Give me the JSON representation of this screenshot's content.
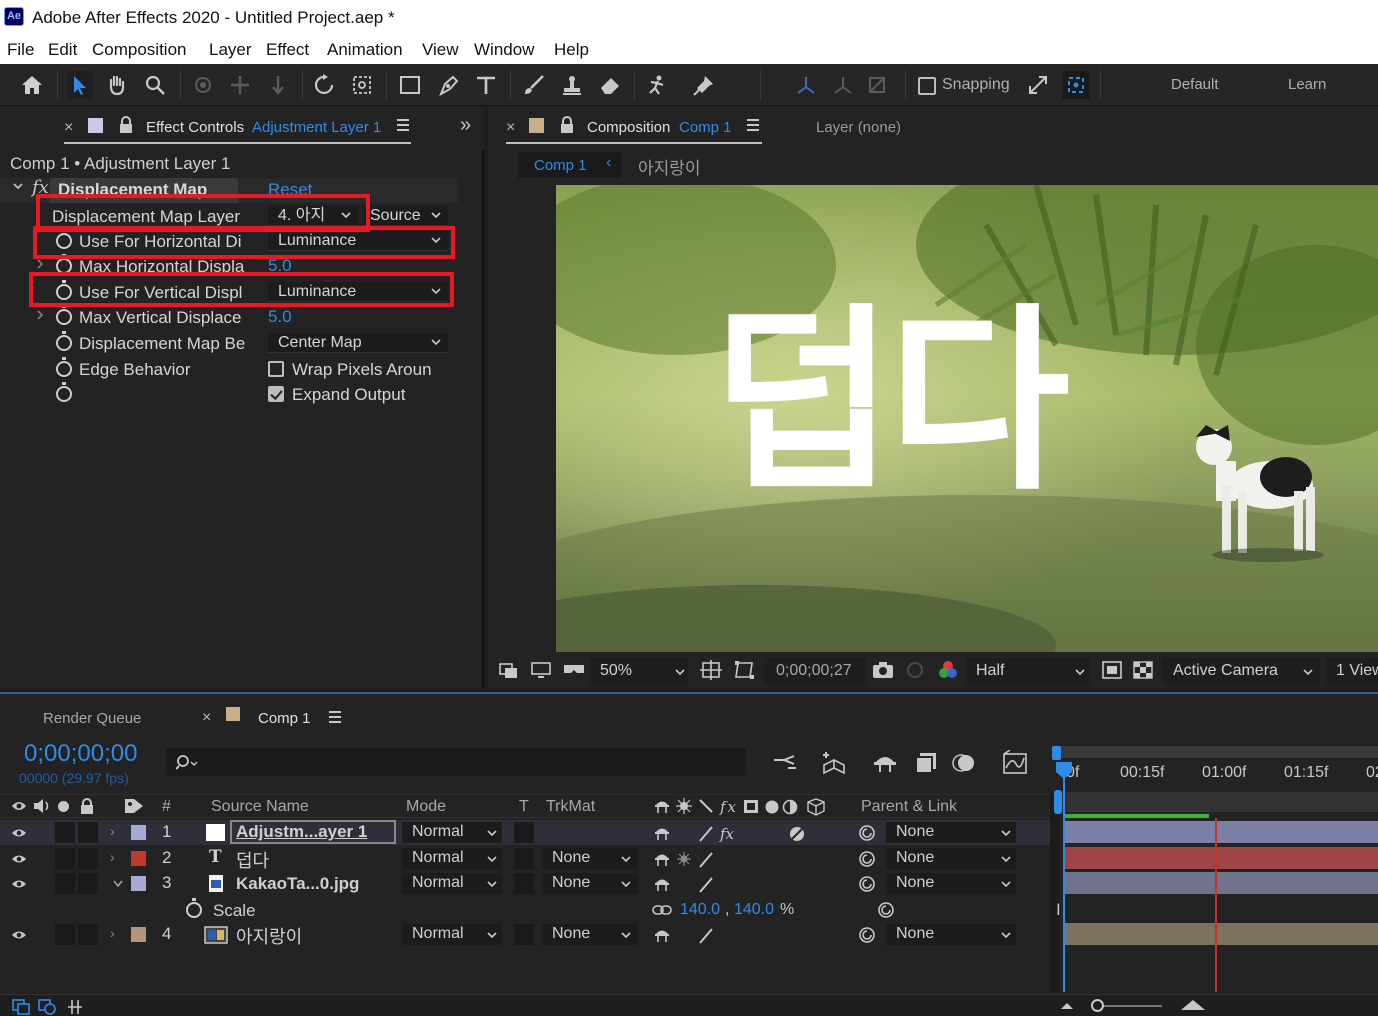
{
  "app": {
    "title": "Adobe After Effects 2020 - Untitled Project.aep *",
    "logo": "Ae"
  },
  "menu": [
    "File",
    "Edit",
    "Composition",
    "Layer",
    "Effect",
    "Animation",
    "View",
    "Window",
    "Help"
  ],
  "toolbar": {
    "snapping": "Snapping",
    "workspaces": [
      "Default",
      "Learn"
    ]
  },
  "effect_controls": {
    "tab_title": "Effect Controls",
    "tab_layer": "Adjustment Layer 1",
    "breadcrumb": "Comp 1 • Adjustment Layer 1",
    "effect_name": "Displacement Map",
    "reset": "Reset",
    "properties": [
      {
        "name": "Displacement Map Layer",
        "value": "4. 아지",
        "extra": "Source"
      },
      {
        "name": "Use For Horizontal Di",
        "value": "Luminance"
      },
      {
        "name": "Max Horizontal Displa",
        "value": "5.0"
      },
      {
        "name": "Use For Vertical Displ",
        "value": "Luminance"
      },
      {
        "name": "Max Vertical Displace",
        "value": "5.0"
      },
      {
        "name": "Displacement Map Be",
        "value": "Center Map"
      },
      {
        "name": "Edge Behavior",
        "value": "Wrap Pixels Aroun",
        "checked": false
      },
      {
        "name": "",
        "value": "Expand Output",
        "checked": true
      }
    ]
  },
  "composition": {
    "tab_title": "Composition",
    "tab_comp": "Comp 1",
    "layer_tab": "Layer (none)",
    "breadcrumb_comp": "Comp 1",
    "breadcrumb_next": "아지랑이",
    "overlay_text": "덥다",
    "zoom": "50%",
    "timecode": "0;00;00;27",
    "resolution": "Half",
    "camera": "Active Camera",
    "views": "1 View"
  },
  "timeline": {
    "render_queue": "Render Queue",
    "comp_tab": "Comp 1",
    "current_time": "0;00;00;00",
    "frame_info": "00000 (29.97 fps)",
    "search_placeholder": "",
    "columns": {
      "num": "#",
      "source": "Source Name",
      "mode": "Mode",
      "t": "T",
      "trkmat": "TrkMat",
      "parent": "Parent & Link"
    },
    "ruler": [
      "0f",
      "00:15f",
      "01:00f",
      "01:15f",
      "02"
    ],
    "layers": [
      {
        "num": "1",
        "name": "Adjustm...ayer 1",
        "mode": "Normal",
        "trkmat": "",
        "parent": "None",
        "color": "#a9a9d6",
        "track_color": "#7c7fa6"
      },
      {
        "num": "2",
        "name": "덥다",
        "mode": "Normal",
        "trkmat": "None",
        "parent": "None",
        "color": "#c0392b",
        "track_color": "#a04545"
      },
      {
        "num": "3",
        "name": "KakaoTa...0.jpg",
        "mode": "Normal",
        "trkmat": "None",
        "parent": "None",
        "color": "#a9a9d6",
        "track_color": "#72738a"
      },
      {
        "num": "4",
        "name": "아지랑이",
        "mode": "Normal",
        "trkmat": "None",
        "parent": "None",
        "color": "#b4977a",
        "track_color": "#7d7160"
      }
    ],
    "scale": {
      "label": "Scale",
      "x": "140.0",
      "sep": ",",
      "y": "140.0",
      "unit": "%"
    }
  },
  "colors": {
    "accent": "#2d8ceb",
    "highlight_box": "#e51a24",
    "panel_bg": "#232323"
  }
}
